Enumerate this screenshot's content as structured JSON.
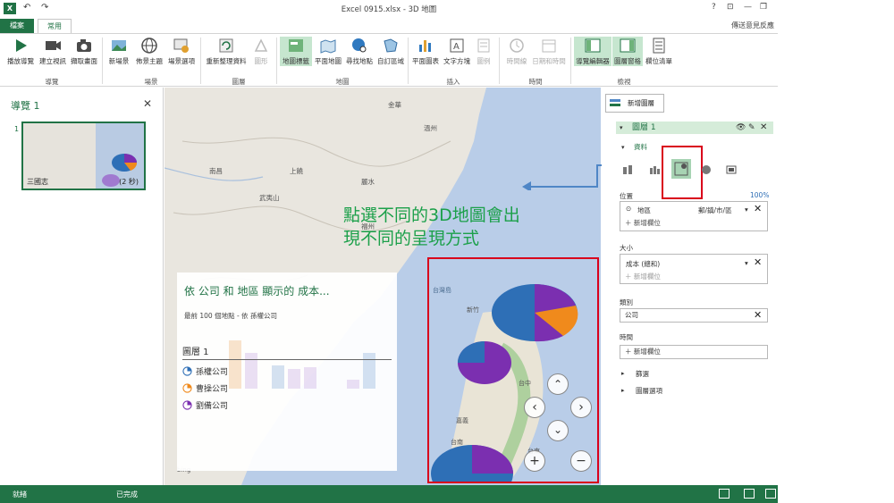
{
  "window": {
    "title": "Excel 0915.xlsx - 3D 地圖",
    "help": "?",
    "feedback": "傳送意見反應"
  },
  "tabs": {
    "file": "檔案",
    "home": "常用"
  },
  "ribbon": {
    "buttons": {
      "play_tour": "播放導覽",
      "create_video": "建立視訊",
      "capture_screen": "擷取畫面",
      "new_scene": "新場景",
      "theme": "佈景主題",
      "scene_options": "場景選項",
      "refresh_data": "重新整理資料",
      "shapes": "圖形",
      "map_labels": "地圖標籤",
      "flat_map": "平面地圖",
      "find_location": "尋找地點",
      "custom_regions": "自訂區域",
      "flat_chart": "平面圖表",
      "text_box": "文字方塊",
      "legend": "圖例",
      "timeline": "時間線",
      "date_time": "日期和時間",
      "tour_editor": "導覽編輯器",
      "layer_pane": "圖層窗格",
      "field_list": "欄位清單"
    },
    "groups": {
      "tour": "導覽",
      "scene": "場景",
      "layer": "圖層",
      "map": "地圖",
      "insert": "插入",
      "time": "時間",
      "view": "檢視"
    }
  },
  "tour_panel": {
    "title": "導覽 1",
    "close": "✕",
    "index": "1",
    "scene_name": "三國志",
    "scene_duration": "(2 秒)"
  },
  "callout": {
    "line1": "點選不同的3D地圖會出",
    "line2": "現不同的呈現方式"
  },
  "legend_card": {
    "title": "依 公司 和 地區 顯示的 成本...",
    "subtitle": "最前 100 個地點 - 依 孫權公司",
    "layer": "圖層 1",
    "items": [
      {
        "label": "孫權公司",
        "color": "#2e6fb6"
      },
      {
        "label": "曹操公司",
        "color": "#f08a1c"
      },
      {
        "label": "劉備公司",
        "color": "#7b2fb0"
      }
    ],
    "bing": "bing"
  },
  "map_labels": {
    "cities": [
      "南昌",
      "福州",
      "台灣島",
      "新竹",
      "台中",
      "嘉義",
      "台南",
      "高雄",
      "台東",
      "上饒",
      "麗水",
      "溫州",
      "金華",
      "浙西",
      "武夷山"
    ],
    "nav": {
      "up": "⌃",
      "left": "‹",
      "right": "›",
      "down": "⌄",
      "zoom_in": "+",
      "zoom_out": "−"
    }
  },
  "task_pane": {
    "add_layer": "新增圖層",
    "layer_name": "圖層 1",
    "data_section": "資料",
    "location_label": "位置",
    "location_pct": "100%",
    "location_field": "地區",
    "location_type": "郵/鎮/市/區",
    "add_field": "新增欄位",
    "size_label": "大小",
    "size_field": "成本 (總和)",
    "category_label": "類別",
    "category_field": "公司",
    "time_label": "時間",
    "filter": "篩選",
    "layer_options": "圖層選項"
  },
  "status": {
    "ready": "就緒",
    "done": "已完成"
  },
  "colors": {
    "excel_green": "#217346",
    "pie_blue": "#2e6fb6",
    "pie_orange": "#f08a1c",
    "pie_purple": "#7b2fb0",
    "highlight_red": "#d9001b",
    "callout_green": "#1ca04a"
  }
}
